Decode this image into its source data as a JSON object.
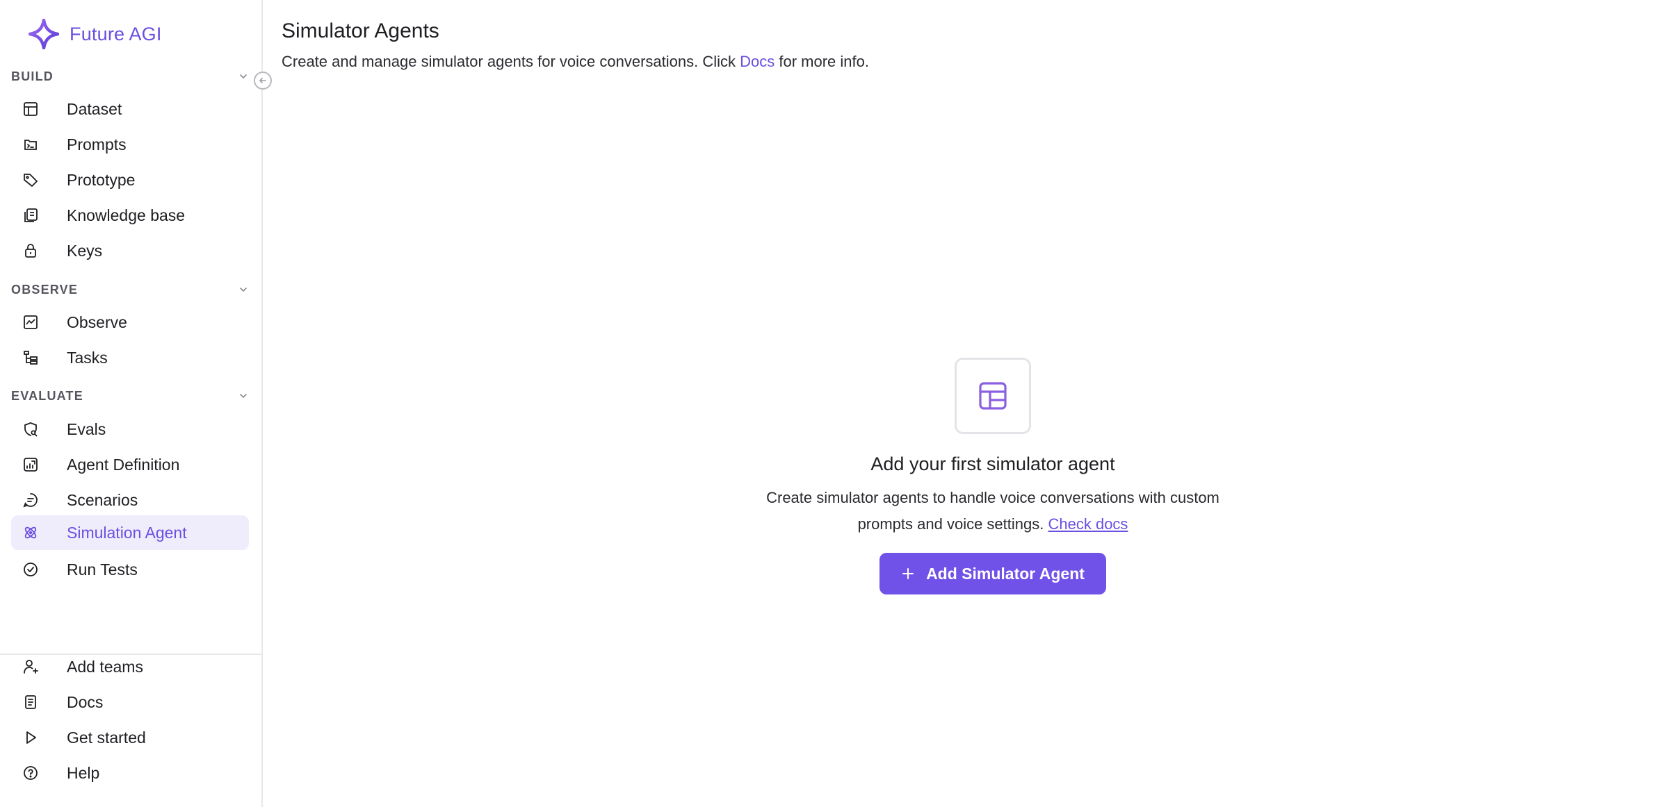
{
  "brand": {
    "name": "Future AGI",
    "accent": "#6b4fe0"
  },
  "sidebar": {
    "sections": [
      {
        "title": "BUILD",
        "items": [
          {
            "label": "Dataset",
            "icon": "table-icon"
          },
          {
            "label": "Prompts",
            "icon": "prompt-icon"
          },
          {
            "label": "Prototype",
            "icon": "tag-icon"
          },
          {
            "label": "Knowledge base",
            "icon": "book-icon"
          },
          {
            "label": "Keys",
            "icon": "lock-icon"
          }
        ]
      },
      {
        "title": "OBSERVE",
        "items": [
          {
            "label": "Observe",
            "icon": "chart-icon"
          },
          {
            "label": "Tasks",
            "icon": "tree-icon"
          }
        ]
      },
      {
        "title": "EVALUATE",
        "items": [
          {
            "label": "Evals",
            "icon": "shield-search-icon"
          },
          {
            "label": "Agent Definition",
            "icon": "agent-chart-icon"
          },
          {
            "label": "Scenarios",
            "icon": "chat-icon"
          },
          {
            "label": "Simulation Agent",
            "icon": "atom-icon",
            "active": true
          },
          {
            "label": "Run Tests",
            "icon": "check-circle-icon"
          }
        ]
      }
    ],
    "bottom": [
      {
        "label": "Add teams",
        "icon": "user-plus-icon"
      },
      {
        "label": "Docs",
        "icon": "document-icon"
      },
      {
        "label": "Get started",
        "icon": "play-icon"
      },
      {
        "label": "Help",
        "icon": "help-icon"
      }
    ]
  },
  "main": {
    "title": "Simulator Agents",
    "subtitle_pre": "Create and manage simulator agents for voice conversations. Click ",
    "subtitle_link": "Docs",
    "subtitle_post": " for more info.",
    "empty": {
      "title": "Add your first simulator agent",
      "desc_pre": "Create simulator agents to handle voice conversations with custom prompts and voice settings. ",
      "desc_link": "Check docs",
      "button_label": "Add Simulator Agent"
    }
  }
}
